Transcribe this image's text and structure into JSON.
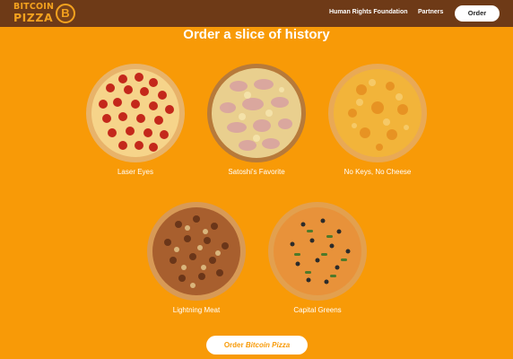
{
  "header": {
    "logo_line1": "BITCOIN",
    "logo_line2": "PIZZA",
    "logo_badge": "B",
    "nav": [
      "Human Rights Foundation",
      "Partners"
    ],
    "order_button": "Order"
  },
  "main": {
    "headline": "Order a slice of history",
    "pizzas": [
      {
        "name": "Laser Eyes",
        "icon": "pepperoni-pizza-icon"
      },
      {
        "name": "Satoshi's Favorite",
        "icon": "ham-pizza-icon"
      },
      {
        "name": "No Keys, No Cheese",
        "icon": "cheese-pizza-icon"
      },
      {
        "name": "Lightning Meat",
        "icon": "meat-pizza-icon"
      },
      {
        "name": "Capital Greens",
        "icon": "veggie-pizza-icon"
      }
    ],
    "order_button_prefix": "Order ",
    "order_button_brand": "Bitcoin Pizza"
  },
  "colors": {
    "background": "#F89A07",
    "header": "#6E3A17",
    "logo": "#F4A21E",
    "button": "#FFFFFF"
  }
}
